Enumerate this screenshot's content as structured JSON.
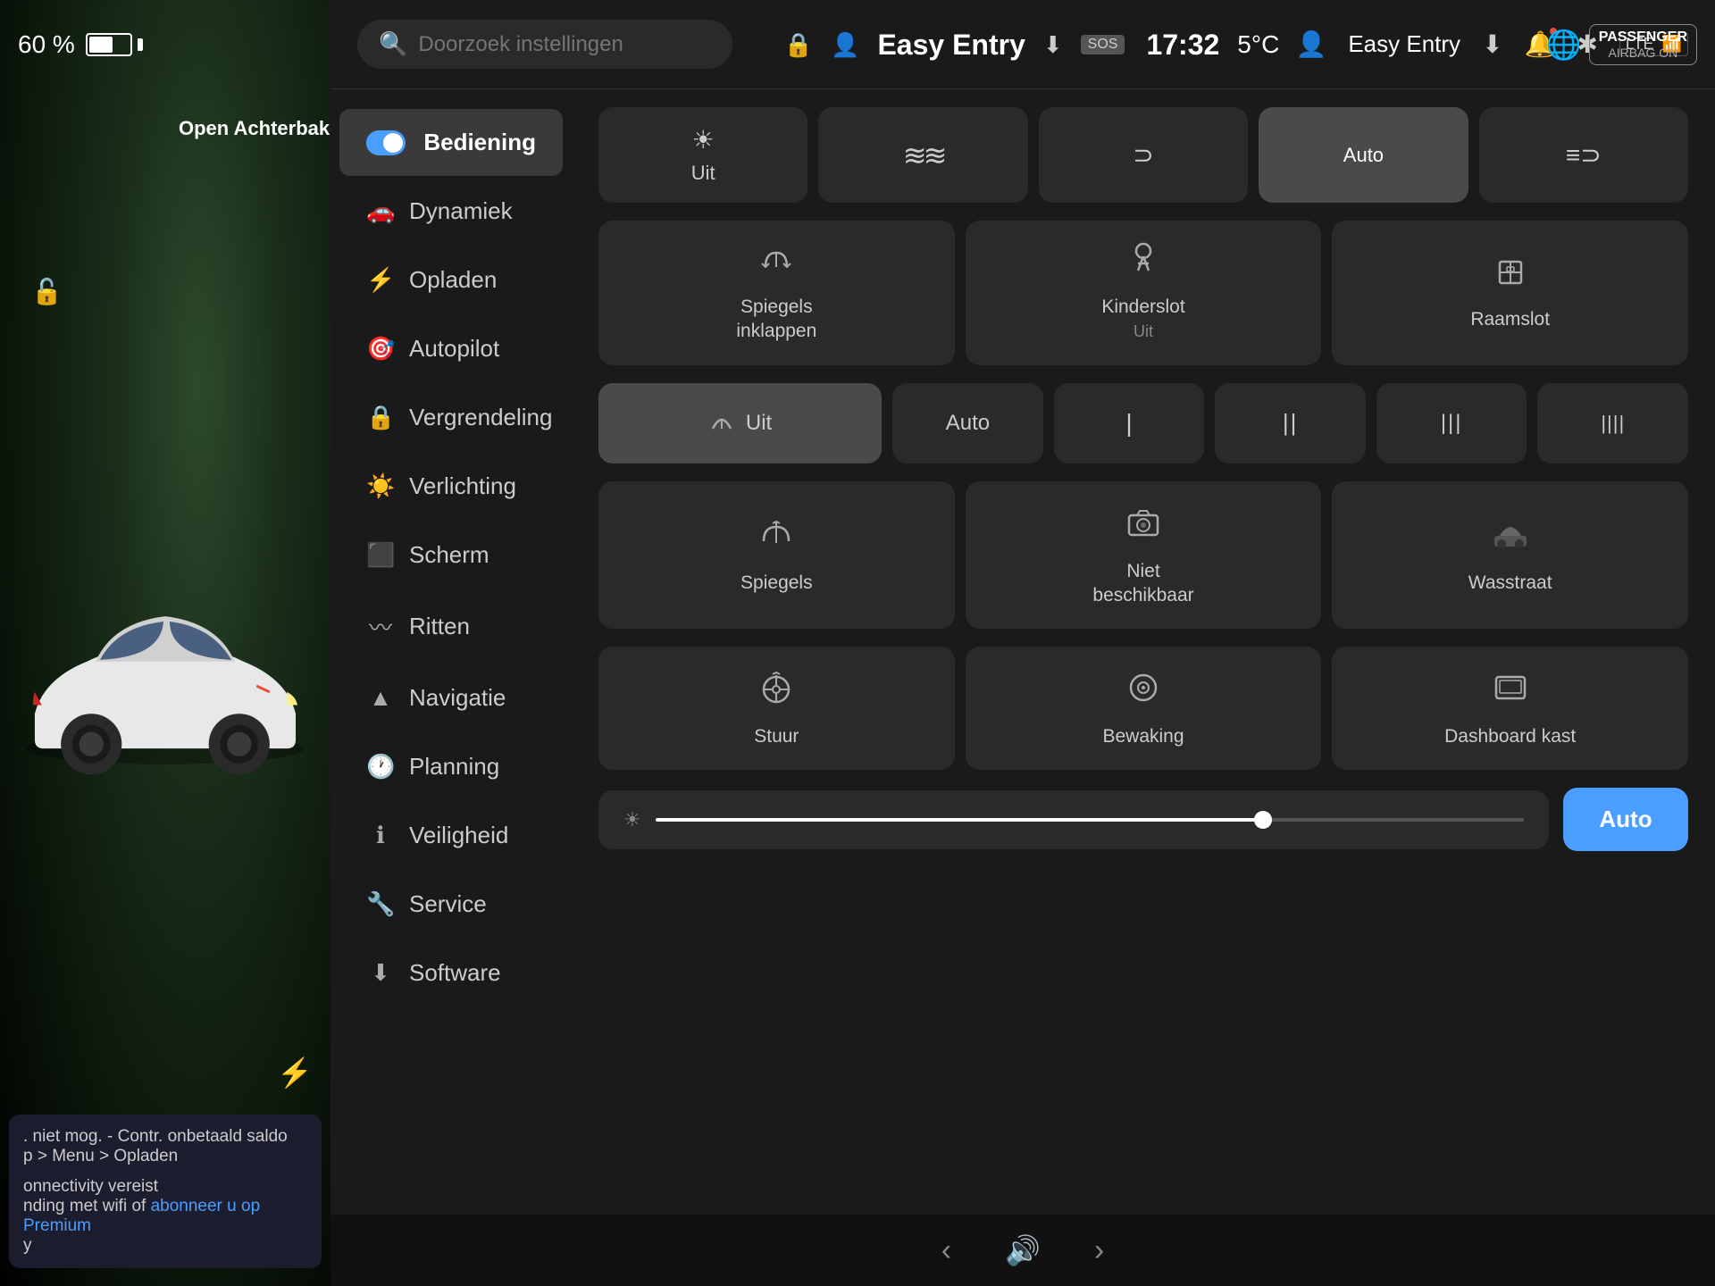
{
  "statusBar": {
    "battery": "60 %",
    "profile": "Easy Entry",
    "speed": "SOS",
    "time": "17:32",
    "temperature": "5°C",
    "airbag": "PASSENGER\nAIRBAG ON"
  },
  "header": {
    "searchPlaceholder": "Doorzoek instellingen",
    "profileName": "Easy Entry"
  },
  "sidebar": {
    "items": [
      {
        "id": "bediening",
        "label": "Bediening",
        "icon": "⚙",
        "active": true
      },
      {
        "id": "dynamiek",
        "label": "Dynamiek",
        "icon": "🚗",
        "active": false
      },
      {
        "id": "opladen",
        "label": "Opladen",
        "icon": "⚡",
        "active": false
      },
      {
        "id": "autopilot",
        "label": "Autopilot",
        "icon": "🎯",
        "active": false
      },
      {
        "id": "vergrendeling",
        "label": "Vergrendeling",
        "icon": "🔒",
        "active": false
      },
      {
        "id": "verlichting",
        "label": "Verlichting",
        "icon": "💡",
        "active": false
      },
      {
        "id": "scherm",
        "label": "Scherm",
        "icon": "📱",
        "active": false
      },
      {
        "id": "ritten",
        "label": "Ritten",
        "icon": "🗺",
        "active": false
      },
      {
        "id": "navigatie",
        "label": "Navigatie",
        "icon": "▲",
        "active": false
      },
      {
        "id": "planning",
        "label": "Planning",
        "icon": "🕐",
        "active": false
      },
      {
        "id": "veiligheid",
        "label": "Veiligheid",
        "icon": "ℹ",
        "active": false
      },
      {
        "id": "service",
        "label": "Service",
        "icon": "🔧",
        "active": false
      },
      {
        "id": "software",
        "label": "Software",
        "icon": "⬇",
        "active": false
      }
    ]
  },
  "lighting": {
    "buttons": [
      {
        "id": "uit",
        "label": "Uit",
        "icon": "☀",
        "active": false
      },
      {
        "id": "drl",
        "label": "",
        "icon": "≋",
        "active": false
      },
      {
        "id": "partial",
        "label": "",
        "icon": "⊃",
        "active": false
      },
      {
        "id": "auto",
        "label": "Auto",
        "icon": "",
        "active": true
      },
      {
        "id": "full",
        "label": "",
        "icon": "≡",
        "active": false
      }
    ]
  },
  "cards": {
    "row1": [
      {
        "id": "spiegels-inklappen",
        "icon": "🪞",
        "label": "Spiegels\ninklappen"
      },
      {
        "id": "kinderslot",
        "icon": "👶",
        "label": "Kinderslot\nUit"
      },
      {
        "id": "raamslot",
        "icon": "🪟",
        "label": "Raamslot"
      }
    ],
    "wipers": [
      {
        "id": "wiper-uit",
        "label": "Uit",
        "icon": "🧹",
        "active": true
      },
      {
        "id": "wiper-auto",
        "label": "Auto",
        "active": false
      },
      {
        "id": "wiper-1",
        "label": "I",
        "active": false
      },
      {
        "id": "wiper-2",
        "label": "II",
        "active": false
      },
      {
        "id": "wiper-3",
        "label": "III",
        "active": false
      },
      {
        "id": "wiper-4",
        "label": "IIII",
        "active": false
      }
    ],
    "row2": [
      {
        "id": "spiegels",
        "icon": "🪞↕",
        "label": "Spiegels"
      },
      {
        "id": "niet-beschikbaar",
        "icon": "📷",
        "label": "Niet\nbeschikbaar"
      },
      {
        "id": "wasstraat",
        "icon": "🚗",
        "label": "Wasstraat"
      }
    ],
    "row3": [
      {
        "id": "stuur",
        "icon": "🎮↕",
        "label": "Stuur"
      },
      {
        "id": "bewaking",
        "icon": "⊙",
        "label": "Bewaking"
      },
      {
        "id": "dashboard-kast",
        "icon": "🖥",
        "label": "Dashboard kast"
      }
    ]
  },
  "brightness": {
    "value": 70,
    "autoLabel": "Auto"
  },
  "carInfo": {
    "openAchterbak": "Open\nAchterbak"
  },
  "notifications": [
    {
      "id": "saldo",
      "text": ". niet mog. - Contr. onbetaald saldo",
      "subtext": "p > Menu > Opladen"
    },
    {
      "id": "connectivity",
      "text": "onnectivity vereist\nnding met wifi of ",
      "linkText": "abonneer u op Premium",
      "suffix": "\ny"
    }
  ],
  "footer": {
    "prevIcon": "‹",
    "volumeIcon": "🔊",
    "nextIcon": "›"
  }
}
